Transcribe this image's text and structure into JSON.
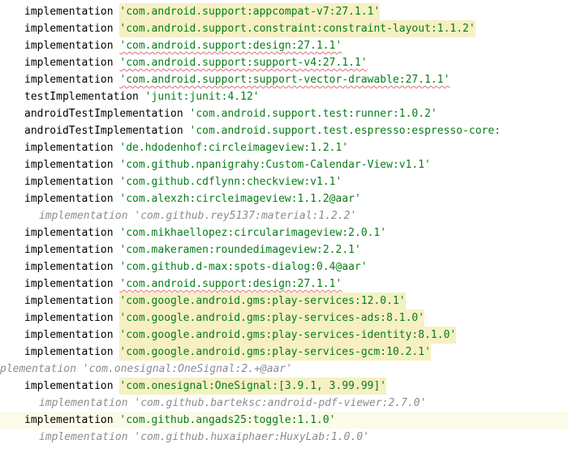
{
  "editor": {
    "lines": [
      {
        "keyword": "implementation",
        "value": "'com.android.support:appcompat-v7:27.1.1'",
        "highlighted": true,
        "warning": false,
        "commented": false,
        "indent": 0
      },
      {
        "keyword": "implementation",
        "value": "'com.android.support.constraint:constraint-layout:1.1.2'",
        "highlighted": true,
        "warning": false,
        "commented": false,
        "indent": 0
      },
      {
        "keyword": "implementation",
        "value": "'com.android.support:design:27.1.1'",
        "highlighted": false,
        "warning": true,
        "commented": false,
        "indent": 0
      },
      {
        "keyword": "implementation",
        "value": "'com.android.support:support-v4:27.1.1'",
        "highlighted": false,
        "warning": true,
        "commented": false,
        "indent": 0
      },
      {
        "keyword": "implementation",
        "value": "'com.android.support:support-vector-drawable:27.1.1'",
        "highlighted": false,
        "warning": true,
        "commented": false,
        "indent": 0
      },
      {
        "keyword": "testImplementation",
        "value": "'junit:junit:4.12'",
        "highlighted": false,
        "warning": false,
        "commented": false,
        "indent": 0
      },
      {
        "keyword": "androidTestImplementation",
        "value": "'com.android.support.test:runner:1.0.2'",
        "highlighted": false,
        "warning": false,
        "commented": false,
        "indent": 0
      },
      {
        "keyword": "androidTestImplementation",
        "value": "'com.android.support.test.espresso:espresso-core:",
        "highlighted": false,
        "warning": false,
        "commented": false,
        "indent": 0
      },
      {
        "keyword": "implementation",
        "value": "'de.hdodenhof:circleimageview:1.2.1'",
        "highlighted": false,
        "warning": false,
        "commented": false,
        "indent": 0
      },
      {
        "keyword": "implementation",
        "value": "'com.github.npanigrahy:Custom-Calendar-View:v1.1'",
        "highlighted": false,
        "warning": false,
        "commented": false,
        "indent": 0
      },
      {
        "keyword": "implementation",
        "value": "'com.github.cdflynn:checkview:v1.1'",
        "highlighted": false,
        "warning": false,
        "commented": false,
        "indent": 0
      },
      {
        "keyword": "implementation",
        "value": "'com.alexzh:circleimageview:1.1.2@aar'",
        "highlighted": false,
        "warning": false,
        "commented": false,
        "indent": 0
      },
      {
        "keyword": "implementation",
        "value": "'com.github.rey5137:material:1.2.2'",
        "highlighted": false,
        "warning": false,
        "commented": true,
        "indent": 1
      },
      {
        "keyword": "implementation",
        "value": "'com.mikhaellopez:circularimageview:2.0.1'",
        "highlighted": false,
        "warning": false,
        "commented": false,
        "indent": 0
      },
      {
        "keyword": "implementation",
        "value": "'com.makeramen:roundedimageview:2.2.1'",
        "highlighted": false,
        "warning": false,
        "commented": false,
        "indent": 0
      },
      {
        "keyword": "implementation",
        "value": "'com.github.d-max:spots-dialog:0.4@aar'",
        "highlighted": false,
        "warning": false,
        "commented": false,
        "indent": 0
      },
      {
        "keyword": "implementation",
        "value": "'com.android.support:design:27.1.1'",
        "highlighted": false,
        "warning": true,
        "commented": false,
        "indent": 0
      },
      {
        "keyword": "implementation",
        "value": "'com.google.android.gms:play-services:12.0.1'",
        "highlighted": true,
        "warning": false,
        "commented": false,
        "indent": 0
      },
      {
        "keyword": "implementation",
        "value": "'com.google.android.gms:play-services-ads:8.1.0'",
        "highlighted": true,
        "warning": false,
        "commented": false,
        "indent": 0
      },
      {
        "keyword": "implementation",
        "value": "'com.google.android.gms:play-services-identity:8.1.0'",
        "highlighted": true,
        "warning": false,
        "commented": false,
        "indent": 0
      },
      {
        "keyword": "implementation",
        "value": "'com.google.android.gms:play-services-gcm:10.2.1'",
        "highlighted": true,
        "warning": false,
        "commented": false,
        "indent": 0
      },
      {
        "keyword": "plementation",
        "value": "'com.onesignal:OneSignal:2.+@aar'",
        "highlighted": false,
        "warning": false,
        "commented": true,
        "indent": -1
      },
      {
        "keyword": "implementation",
        "value": "'com.onesignal:OneSignal:[3.9.1, 3.99.99]'",
        "highlighted": true,
        "warning": false,
        "commented": false,
        "indent": 0
      },
      {
        "keyword": "implementation",
        "value": "'com.github.barteksc:android-pdf-viewer:2.7.0'",
        "highlighted": false,
        "warning": false,
        "commented": true,
        "indent": 1
      },
      {
        "keyword": "implementation",
        "value": "'com.github.angads25:toggle:1.1.0'",
        "highlighted": false,
        "warning": false,
        "commented": false,
        "indent": 0,
        "current": true
      },
      {
        "keyword": "implementation",
        "value": "'com.github.huxaiphaer:HuxyLab:1.0.0'",
        "highlighted": false,
        "warning": false,
        "commented": true,
        "indent": 1
      }
    ]
  }
}
